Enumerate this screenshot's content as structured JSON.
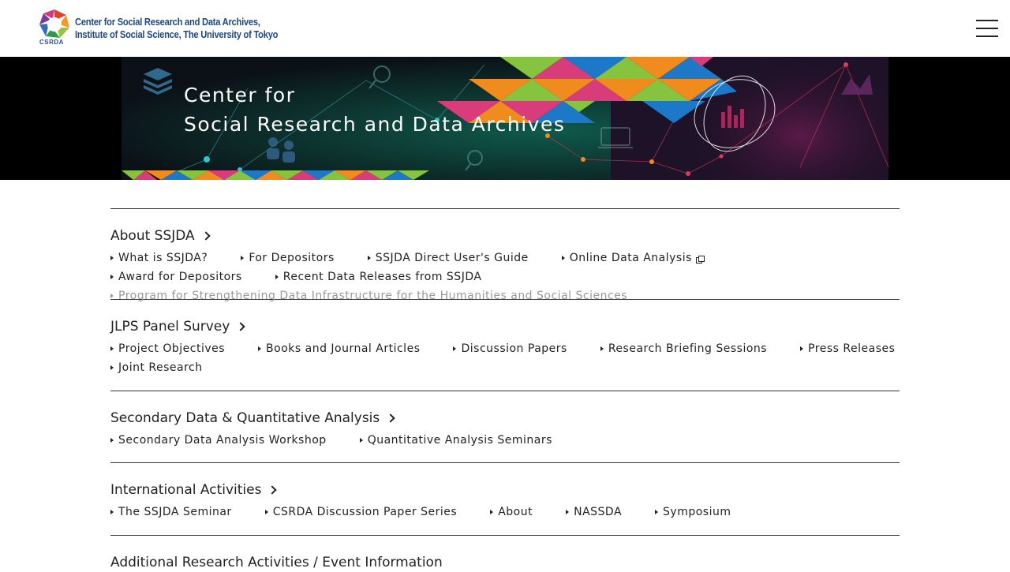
{
  "header": {
    "logo_line1": "Center for Social Research and Data Archives,",
    "logo_line2": "Institute of Social Science, The University of Tokyo",
    "logo_abbr": "CSRDA",
    "menu_icon": "hamburger-menu-icon"
  },
  "banner": {
    "title_line1": "Center for",
    "title_line2": "Social Research and Data Archives"
  },
  "colors": {
    "logo_text": "#1f4a86",
    "banner_bg": "#000000",
    "triangle_green": "#86c440",
    "triangle_blue": "#1e78c8",
    "triangle_pink": "#d83c7a",
    "triangle_orange": "#f08c1e",
    "muted_link": "#999999"
  },
  "sections": [
    {
      "title": "About SSJDA",
      "links": [
        {
          "label": "What is SSJDA?"
        },
        {
          "label": "For Depositors"
        },
        {
          "label": "SSJDA Direct User's Guide"
        },
        {
          "label": "Online Data Analysis",
          "external": true
        },
        {
          "label": "Award for Depositors"
        },
        {
          "label": "Recent Data Releases from SSJDA"
        },
        {
          "label": "Program for Strengthening Data Infrastructure for the Humanities and Social Sciences",
          "muted": true
        }
      ]
    },
    {
      "title": "JLPS Panel Survey",
      "links": [
        {
          "label": "Project Objectives"
        },
        {
          "label": "Books and Journal Articles"
        },
        {
          "label": "Discussion Papers"
        },
        {
          "label": "Research Briefing Sessions"
        },
        {
          "label": "Press Releases"
        },
        {
          "label": "Joint Research"
        }
      ]
    },
    {
      "title": "Secondary Data & Quantitative Analysis",
      "links": [
        {
          "label": "Secondary Data Analysis Workshop"
        },
        {
          "label": "Quantitative Analysis Seminars"
        }
      ]
    },
    {
      "title": "International Activities",
      "links": [
        {
          "label": "The SSJDA Seminar"
        },
        {
          "label": "CSRDA Discussion Paper Series"
        },
        {
          "label": "About"
        },
        {
          "label": "NASSDA"
        },
        {
          "label": "Symposium"
        }
      ]
    },
    {
      "title": "Additional Research Activities / Event Information",
      "links": []
    }
  ]
}
